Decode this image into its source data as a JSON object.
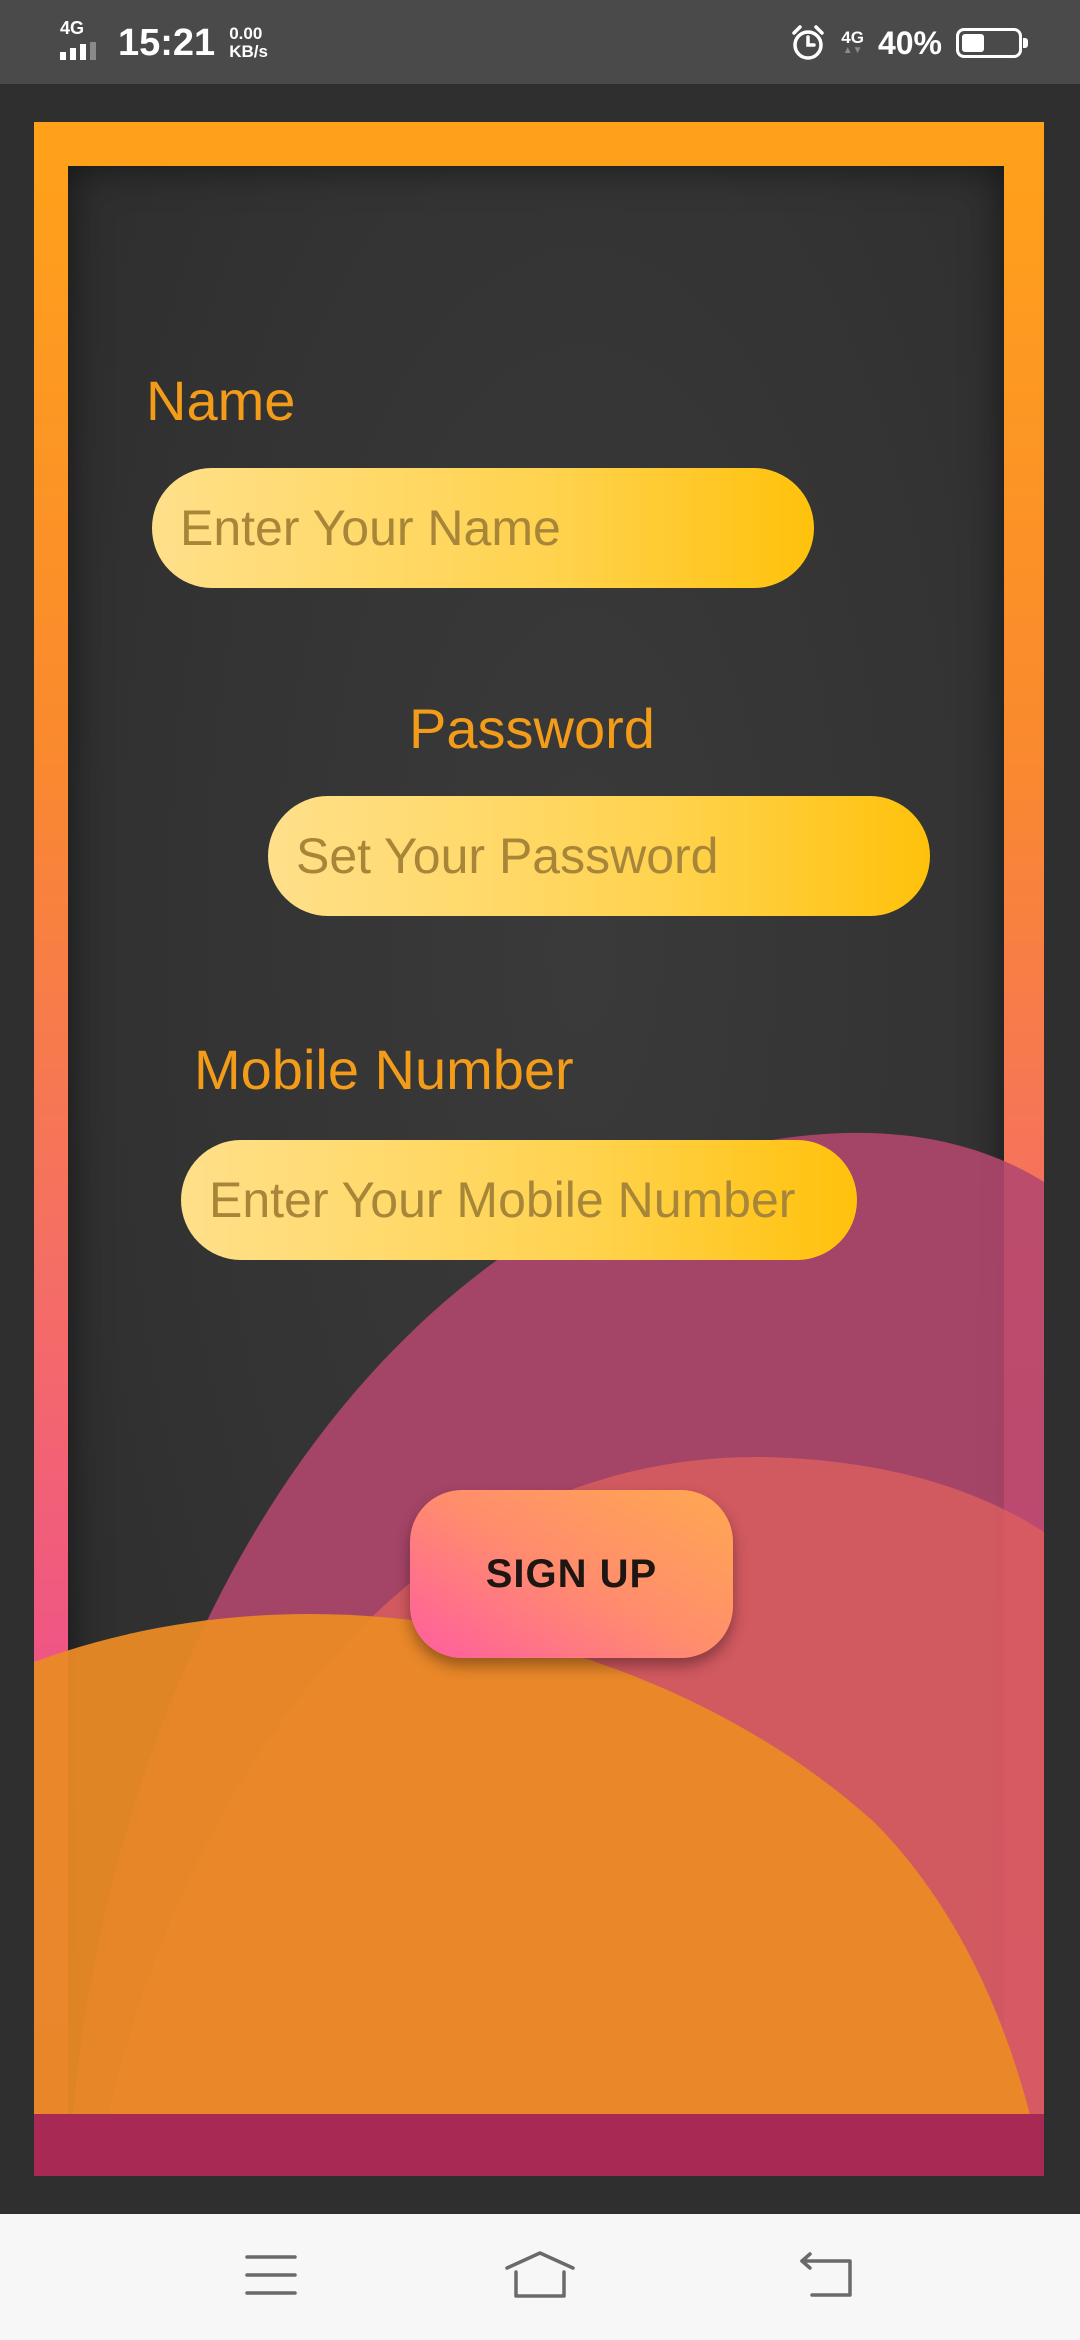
{
  "status_bar": {
    "network_left": "4G",
    "time": "15:21",
    "speed_value": "0.00",
    "speed_unit": "KB/s",
    "network_right": "4G",
    "battery_percent": "40%",
    "battery_level": 0.4,
    "icons": [
      "signal-icon",
      "alarm-icon",
      "battery-icon"
    ]
  },
  "form": {
    "name_label": "Name",
    "name_placeholder": "Enter Your Name",
    "password_label": "Password",
    "password_placeholder": "Set Your Password",
    "mobile_label": "Mobile Number",
    "mobile_placeholder": "Enter Your Mobile Number",
    "signup_label": "SIGN UP"
  },
  "colors": {
    "accent_orange": "#f39c19",
    "field_yellow": "#ffd34f",
    "button_pink": "#ff5d9f",
    "wave_magenta": "#a8456a",
    "wave_orange": "#e88a27"
  },
  "nav_bar": {
    "icons": [
      "menu-icon",
      "home-icon",
      "back-icon"
    ]
  }
}
